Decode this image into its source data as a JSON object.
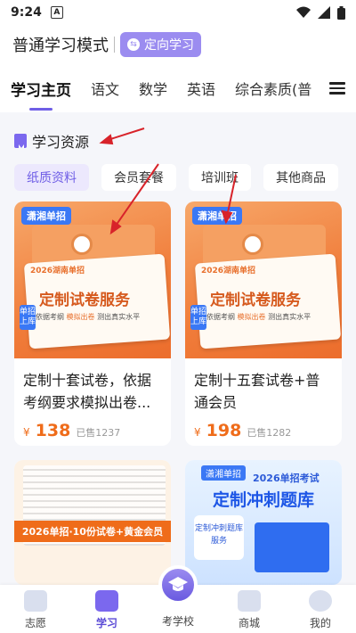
{
  "status_bar": {
    "time": "9:24",
    "notif": "A"
  },
  "header": {
    "title": "普通学习模式",
    "badge": "定向学习"
  },
  "tabs": [
    "学习主页",
    "语文",
    "数学",
    "英语",
    "综合素质(普"
  ],
  "section": {
    "title": "学习资源"
  },
  "chips": [
    "纸质资料",
    "会员套餐",
    "培训班",
    "其他商品"
  ],
  "products": [
    {
      "tag": "潇湘单招",
      "img_sub": "2026湖南单招",
      "img_main": "定制试卷服务",
      "img_line_a": "依据考纲",
      "img_line_hl": "模拟出卷",
      "img_line_b": "测出真实水平",
      "side": "单招上库",
      "title": "定制十套试卷，依据考纲要求模拟出卷...",
      "price_symbol": "¥",
      "price": "138",
      "sold": "已售1237"
    },
    {
      "tag": "潇湘单招",
      "img_sub": "2026湖南单招",
      "img_main": "定制试卷服务",
      "img_line_a": "依据考纲",
      "img_line_hl": "模拟出卷",
      "img_line_b": "测出真实水平",
      "side": "单招上库",
      "title": "定制十五套试卷+普通会员",
      "price_symbol": "¥",
      "price": "198",
      "sold": "已售1282"
    }
  ],
  "bottom_cards": {
    "left_banner": "2026单招·10份试卷+黄金会员",
    "right_tag": "潇湘单招",
    "right_sub": "2026单招考试",
    "right_main": "定制冲刺题库",
    "right_pill": "定制冲刺题库服务"
  },
  "tabbar": {
    "items": [
      "志愿",
      "学习",
      "考学校",
      "商城",
      "我的"
    ],
    "active_index": 1
  },
  "colors": {
    "accent": "#6f5ee6",
    "price": "#ef6c1a",
    "arrow": "#d8232a"
  }
}
